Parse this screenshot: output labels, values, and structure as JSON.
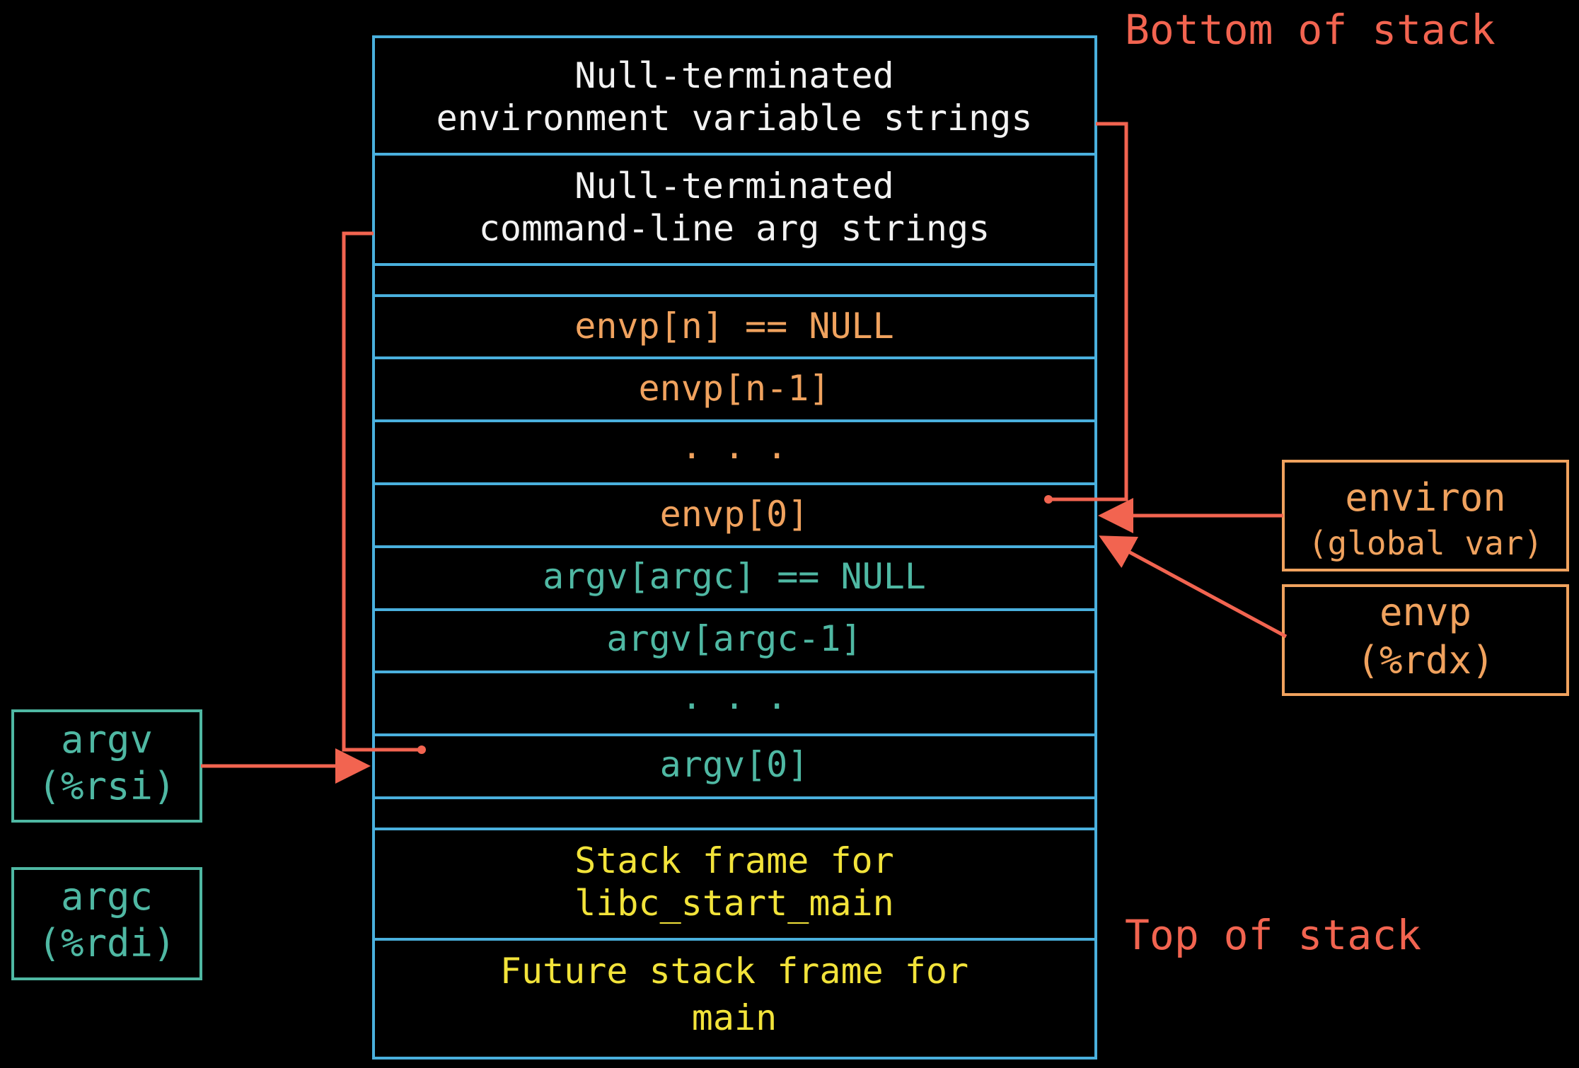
{
  "colors": {
    "background": "#000000",
    "stack_border": "#4ab0dd",
    "pointer_arrow": "#f26450",
    "env_text": "#f0a25e",
    "argv_text": "#4fb8a3",
    "frame_text": "#f2e33a",
    "string_text": "#f2f2f2",
    "edge_label": "#f26450"
  },
  "edge_labels": {
    "bottom": "Bottom of stack",
    "top": "Top of stack"
  },
  "stack": {
    "env_strings": [
      "Null-terminated",
      "environment variable strings"
    ],
    "arg_strings": [
      "Null-terminated",
      "command-line arg strings"
    ],
    "envp_n": "envp[n] == NULL",
    "envp_n_minus_1": "envp[n-1]",
    "envp_dots": ". . .",
    "envp_0": "envp[0]",
    "argv_argc": "argv[argc] == NULL",
    "argv_argc_minus_1": "argv[argc-1]",
    "argv_dots": ". . .",
    "argv_0": "argv[0]",
    "libc_frame": [
      "Stack frame for",
      "libc_start_main"
    ],
    "main_frame": [
      "Future stack frame for",
      "main"
    ]
  },
  "registers": {
    "environ": {
      "name": "environ",
      "note": "(global var)"
    },
    "envp": {
      "name": "envp",
      "note": "(%rdx)"
    },
    "argv": {
      "name": "argv",
      "note": "(%rsi)"
    },
    "argc": {
      "name": "argc",
      "note": "(%rdi)"
    }
  }
}
